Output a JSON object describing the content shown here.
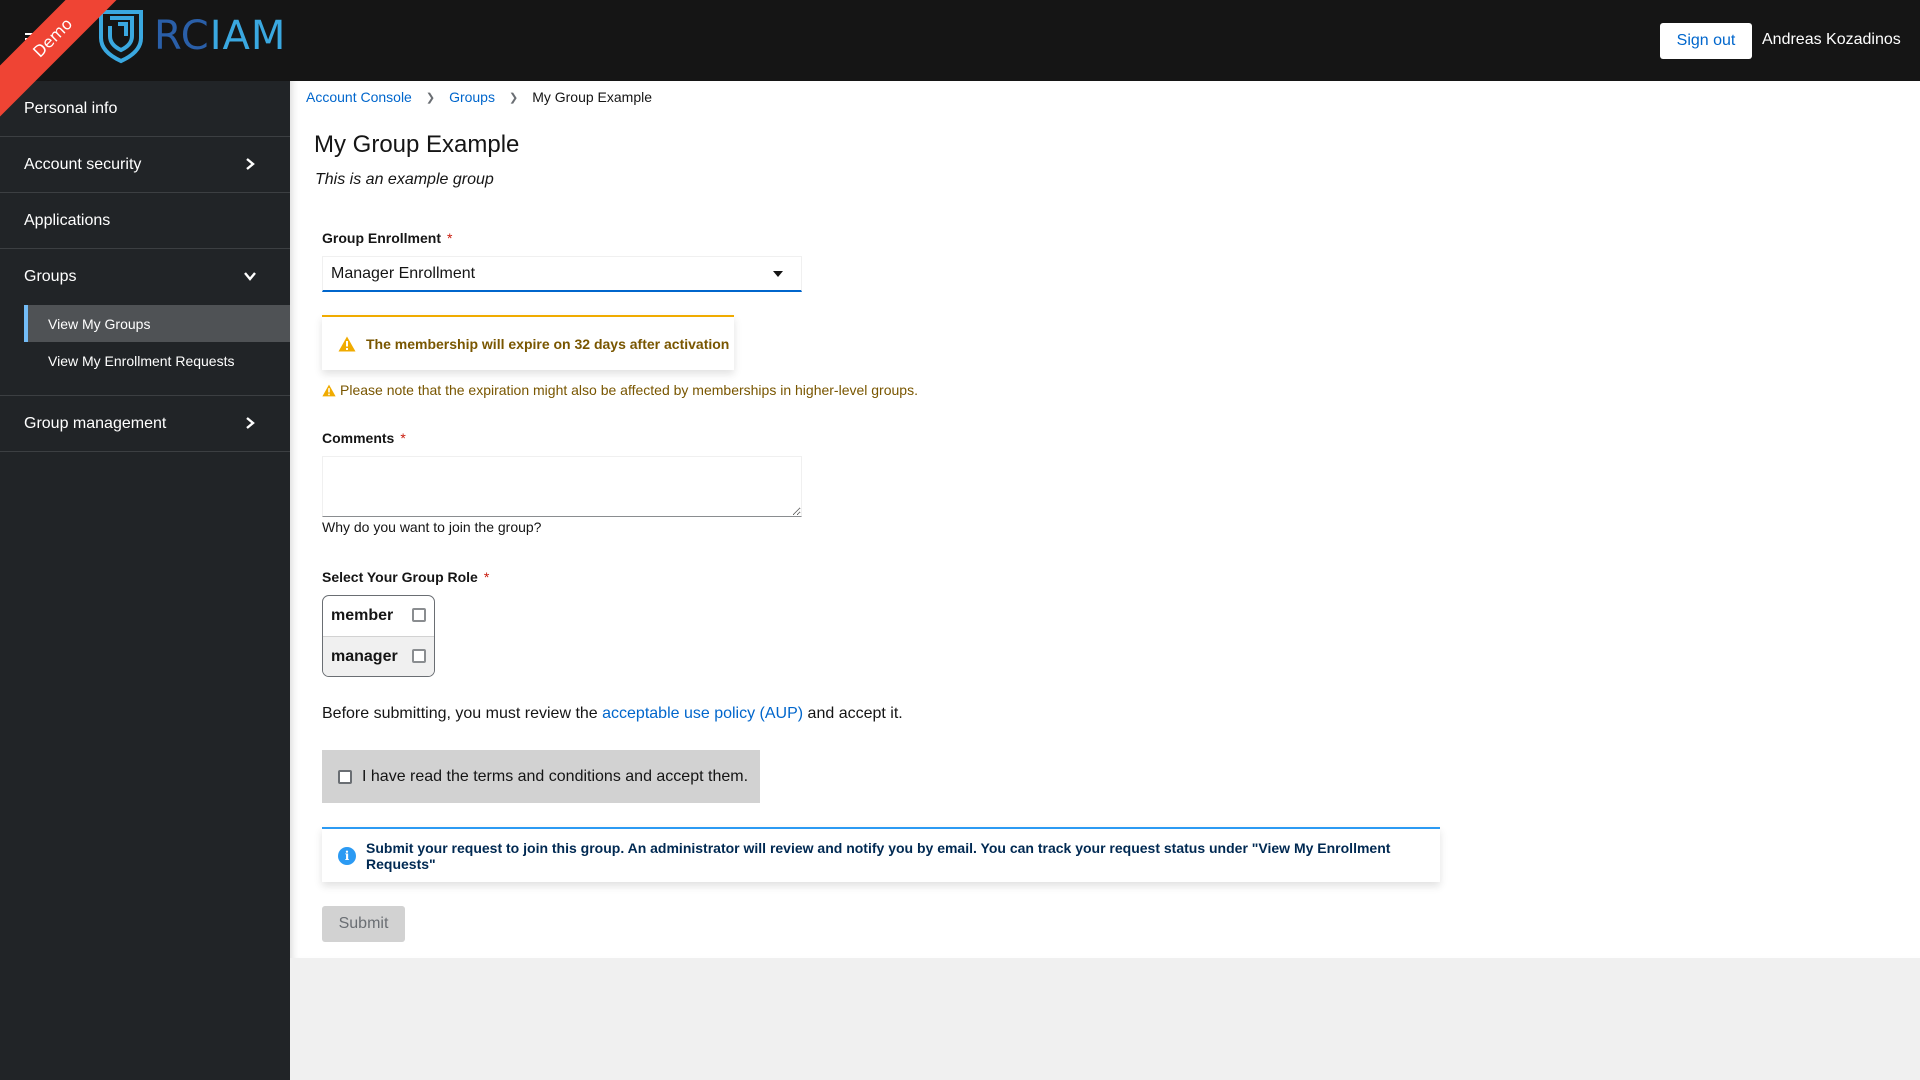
{
  "header": {
    "logo_text_primary": "RC",
    "logo_text_secondary": "IAM",
    "ribbon_label": "Demo",
    "signout_label": "Sign out",
    "username": "Andreas Kozadinos",
    "icons": {
      "menu": "hamburger-icon",
      "logo": "shield-logo-icon"
    }
  },
  "sidebar": {
    "items": [
      {
        "label": "Personal info",
        "has_chevron": false
      },
      {
        "label": "Account security",
        "has_chevron": true,
        "expanded": false
      },
      {
        "label": "Applications",
        "has_chevron": false
      },
      {
        "label": "Groups",
        "has_chevron": true,
        "expanded": true,
        "children": [
          {
            "label": "View My Groups",
            "active": true
          },
          {
            "label": "View My Enrollment Requests",
            "active": false
          }
        ]
      },
      {
        "label": "Group management",
        "has_chevron": true,
        "expanded": false
      }
    ]
  },
  "breadcrumb": [
    {
      "label": "Account Console",
      "link": true
    },
    {
      "label": "Groups",
      "link": true
    },
    {
      "label": "My Group Example",
      "link": false
    }
  ],
  "page": {
    "title": "My Group Example",
    "subtitle": "This is an example group"
  },
  "form": {
    "enrollment": {
      "label": "Group Enrollment",
      "required_mark": "*",
      "selected": "Manager Enrollment"
    },
    "expiration_alert": "The membership will expire on 32 days after activation",
    "expiration_note": "Please note that the expiration might also be affected by memberships in higher-level groups.",
    "comments": {
      "label": "Comments",
      "required_mark": "*",
      "value": "",
      "helper": "Why do you want to join the group?"
    },
    "role": {
      "label": "Select Your Group Role",
      "required_mark": "*",
      "options": [
        {
          "label": "member",
          "checked": false
        },
        {
          "label": "manager",
          "checked": false
        }
      ]
    },
    "aup": {
      "prefix": "Before submitting, you must review the ",
      "link_label": "acceptable use policy (AUP)",
      "suffix": " and accept it."
    },
    "terms": {
      "label": "I have read the terms and conditions and accept them.",
      "checked": false
    },
    "info_alert": "Submit your request to join this group. An administrator will review and notify you by email. You can track your request status under \"View My Enrollment Requests\"",
    "submit_label": "Submit",
    "submit_disabled": true
  },
  "colors": {
    "header_bg": "#151515",
    "sidebar_bg": "#212427",
    "link": "#0066cc",
    "warning": "#f0ab00",
    "info": "#2b9af3",
    "ribbon": "#ef4434"
  }
}
